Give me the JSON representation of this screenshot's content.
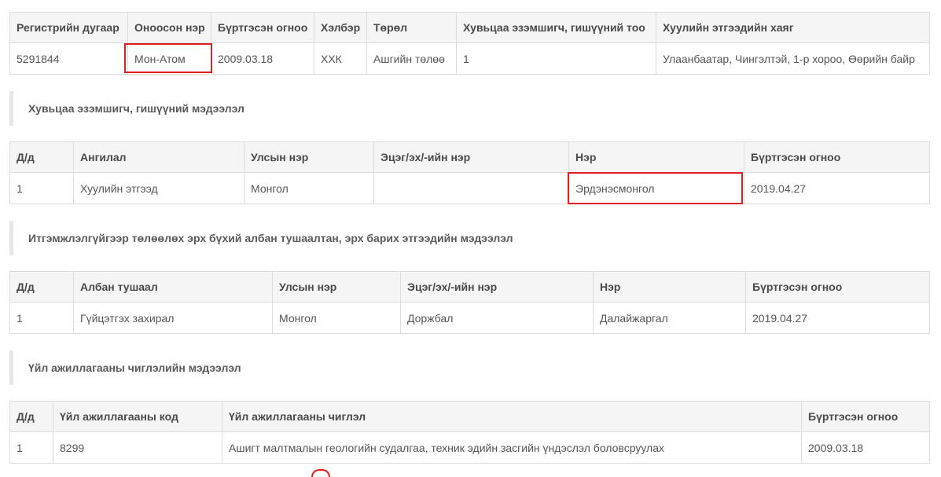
{
  "company": {
    "headers": [
      "Регистрийн дугаар",
      "Оноосон нэр",
      "Бүртгэсэн огноо",
      "Хэлбэр",
      "Төрөл",
      "Хувьцаа эзэмшигч, гишүүний тоо",
      "Хуулийн этгээдийн хаяг"
    ],
    "row": [
      "5291844",
      "Мон-Атом",
      "2009.03.18",
      "ХХК",
      "Ашгийн төлөө",
      "1",
      "Улаанбаатар, Чингэлтэй, 1-р хороо, Өөрийн байр"
    ]
  },
  "shareholders": {
    "title": "Хувьцаа эзэмшигч, гишүүний мэдээлэл",
    "headers": [
      "Д/д",
      "Ангилал",
      "Улсын нэр",
      "Эцэг/эх/-ийн нэр",
      "Нэр",
      "Бүртгэсэн огноо"
    ],
    "row": [
      "1",
      "Хуулийн этгээд",
      "Монгол",
      "",
      "Эрдэнэсмонгол",
      "2019.04.27"
    ]
  },
  "officials": {
    "title": "Итгэмжлэлгүйгээр төлөөлөх эрх бүхий албан тушаалтан, эрх барих этгээдийн мэдээлэл",
    "headers": [
      "Д/д",
      "Албан тушаал",
      "Улсын нэр",
      "Эцэг/эх/-ийн нэр",
      "Нэр",
      "Бүртгэсэн огноо"
    ],
    "row": [
      "1",
      "Гүйцэтгэх захирал",
      "Монгол",
      "Доржбал",
      "Далайжаргал",
      "2019.04.27"
    ]
  },
  "activities": {
    "title": "Үйл ажиллагааны чиглэлийн мэдээлэл",
    "headers": [
      "Д/д",
      "Үйл ажиллагааны код",
      "Үйл ажиллагааны чиглэл",
      "Бүртгэсэн огноо"
    ],
    "row": [
      "1",
      "8299",
      "Ашигт малтмалын геологийн судалгаа, техник эдийн засгийн үндэслэл боловсруулах",
      "2009.03.18"
    ]
  },
  "highlight_color": "#e02020"
}
